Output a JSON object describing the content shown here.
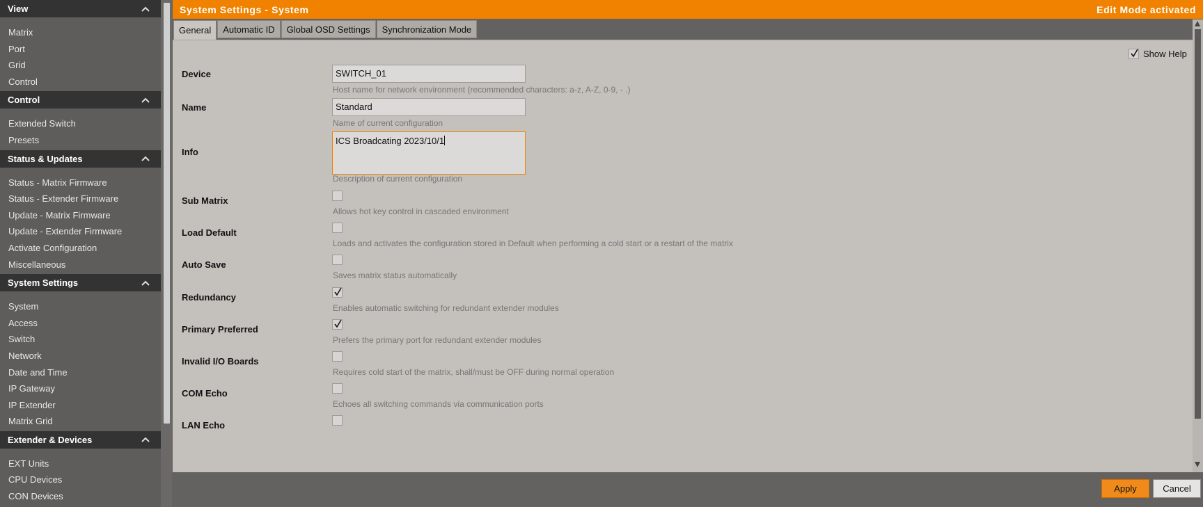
{
  "sidebar": {
    "sections": [
      {
        "title": "View",
        "items": [
          "Matrix",
          "Port",
          "Grid",
          "Control"
        ]
      },
      {
        "title": "Control",
        "items": [
          "Extended Switch",
          "Presets"
        ]
      },
      {
        "title": "Status & Updates",
        "items": [
          "Status - Matrix Firmware",
          "Status - Extender Firmware",
          "Update - Matrix Firmware",
          "Update - Extender Firmware",
          "Activate Configuration",
          "Miscellaneous"
        ]
      },
      {
        "title": "System Settings",
        "items": [
          "System",
          "Access",
          "Switch",
          "Network",
          "Date and Time",
          "IP Gateway",
          "IP Extender",
          "Matrix Grid"
        ]
      },
      {
        "title": "Extender & Devices",
        "items": [
          "EXT Units",
          "CPU Devices",
          "CON Devices"
        ]
      }
    ]
  },
  "header": {
    "title": "System Settings - System",
    "mode": "Edit Mode activated",
    "accent_color": "#f08200"
  },
  "tabs": [
    {
      "label": "General",
      "active": true
    },
    {
      "label": "Automatic ID",
      "active": false
    },
    {
      "label": "Global OSD Settings",
      "active": false
    },
    {
      "label": "Synchronization Mode",
      "active": false
    }
  ],
  "show_help": {
    "label": "Show Help",
    "checked": true
  },
  "fields": {
    "device": {
      "label": "Device",
      "value": "SWITCH_01",
      "help": "Host name for network environment (recommended characters: a-z, A-Z, 0-9, - .)"
    },
    "name": {
      "label": "Name",
      "value": "Standard",
      "help": "Name of current configuration"
    },
    "info": {
      "label": "Info",
      "value": "ICS Broadcating 2023/10/1",
      "help": "Description of current configuration"
    }
  },
  "options": [
    {
      "label": "Sub Matrix",
      "checked": false,
      "help": "Allows hot key control in cascaded environment"
    },
    {
      "label": "Load Default",
      "checked": false,
      "help": "Loads and activates the configuration stored in Default when performing a cold start or a restart of the matrix"
    },
    {
      "label": "Auto Save",
      "checked": false,
      "help": "Saves matrix status automatically"
    },
    {
      "label": "Redundancy",
      "checked": true,
      "help": "Enables automatic switching for redundant extender modules"
    },
    {
      "label": "Primary Preferred",
      "checked": true,
      "help": "Prefers the primary port for redundant extender modules"
    },
    {
      "label": "Invalid I/O Boards",
      "checked": false,
      "help": "Requires cold start of the matrix, shall/must be OFF during normal operation"
    },
    {
      "label": "COM Echo",
      "checked": false,
      "help": "Echoes all switching commands via communication ports"
    },
    {
      "label": "LAN Echo",
      "checked": false,
      "help": ""
    }
  ],
  "buttons": {
    "apply": "Apply",
    "cancel": "Cancel"
  }
}
